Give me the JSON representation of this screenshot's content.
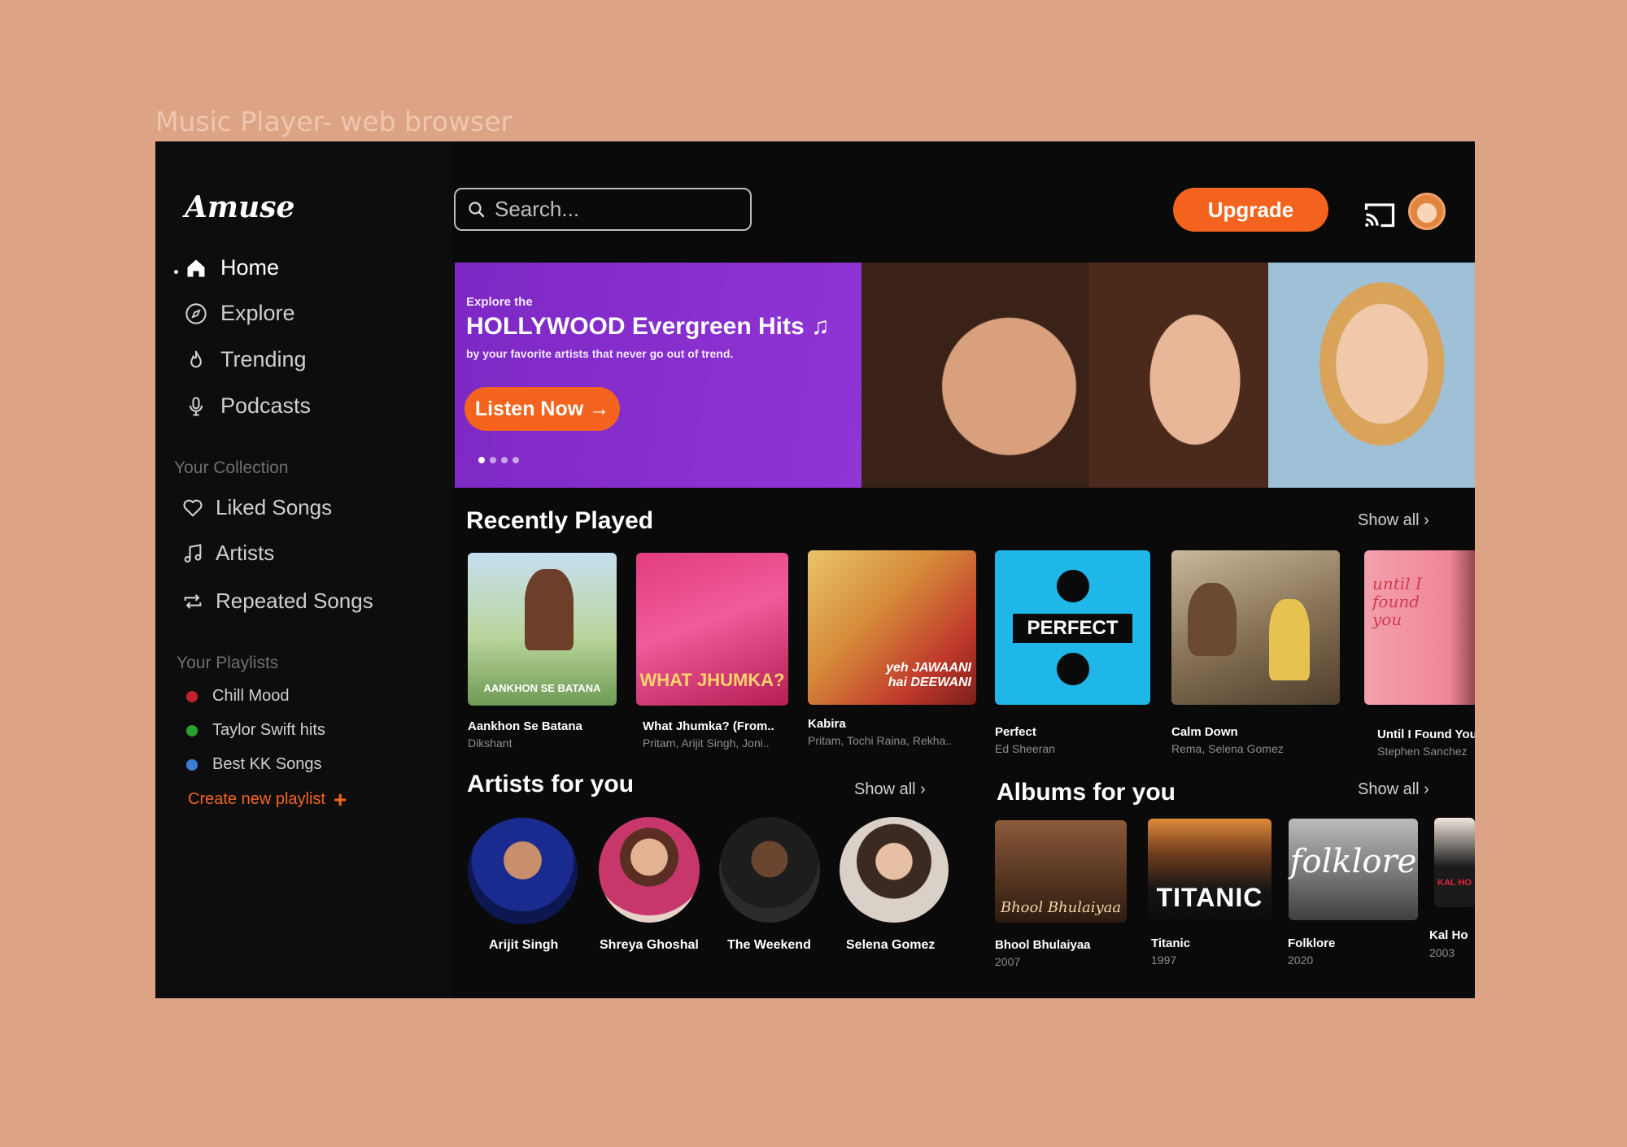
{
  "caption": "Music Player- web browser",
  "brand": {
    "logo": "Amuse"
  },
  "nav": [
    {
      "label": "Home",
      "icon": "home-icon",
      "active": true
    },
    {
      "label": "Explore",
      "icon": "compass-icon"
    },
    {
      "label": "Trending",
      "icon": "flame-icon"
    },
    {
      "label": "Podcasts",
      "icon": "microphone-icon"
    }
  ],
  "collection": {
    "title": "Your Collection",
    "items": [
      {
        "label": "Liked Songs",
        "icon": "heart-icon"
      },
      {
        "label": "Artists",
        "icon": "music-note-icon"
      },
      {
        "label": "Repeated Songs",
        "icon": "repeat-icon"
      }
    ]
  },
  "playlists": {
    "title": "Your Playlists",
    "items": [
      {
        "label": "Chill Mood",
        "color": "#c4222b"
      },
      {
        "label": "Taylor Swift hits",
        "color": "#2ca02c"
      },
      {
        "label": "Best KK Songs",
        "color": "#3a7bd5"
      }
    ],
    "create_label": "Create new playlist",
    "create_symbol": "+"
  },
  "topbar": {
    "search_placeholder": "Search...",
    "upgrade_label": "Upgrade"
  },
  "banner": {
    "kicker": "Explore the",
    "title": "HOLLYWOOD Evergreen Hits",
    "title_glyph": "♫",
    "subtitle": "by your favorite artists that never go out of trend.",
    "cta": "Listen Now →",
    "slides": 4,
    "active_slide": 1
  },
  "recently_played": {
    "title": "Recently Played",
    "show_all": "Show all ›",
    "items": [
      {
        "title": "Aankhon Se Batana",
        "subtitle": "Dikshant",
        "cover_text": "AANKHON SE BATANA"
      },
      {
        "title": "What Jhumka? (From..",
        "subtitle": "Pritam, Arijit Singh, Joni..",
        "cover_text": "WHAT JHUMKA?"
      },
      {
        "title": "Kabira",
        "subtitle": "Pritam, Tochi Raina, Rekha..",
        "cover_text": "yeh JAWAANI hai DEEWANI"
      },
      {
        "title": "Perfect",
        "subtitle": "Ed Sheeran",
        "cover_text": "PERFECT"
      },
      {
        "title": "Calm Down",
        "subtitle": "Rema, Selena Gomez",
        "cover_text": ""
      },
      {
        "title": "Until I Found You",
        "subtitle": "Stephen Sanchez",
        "cover_text": "until I found you"
      }
    ]
  },
  "artists": {
    "title": "Artists for you",
    "show_all": "Show all ›",
    "items": [
      {
        "name": "Arijit Singh"
      },
      {
        "name": "Shreya Ghoshal"
      },
      {
        "name": "The Weekend"
      },
      {
        "name": "Selena Gomez"
      }
    ]
  },
  "albums": {
    "title": "Albums for you",
    "show_all": "Show all ›",
    "items": [
      {
        "title": "Bhool Bhulaiyaa",
        "year": "2007",
        "cover_text": "Bhool Bhulaiyaa"
      },
      {
        "title": "Titanic",
        "year": "1997",
        "cover_text": "TITANIC"
      },
      {
        "title": "Folklore",
        "year": "2020",
        "cover_text": "folklore"
      },
      {
        "title": "Kal Ho",
        "year": "2003",
        "cover_text": "KAL HO"
      }
    ]
  },
  "colors": {
    "accent": "#f5641e",
    "background": "#0a0a0b",
    "page": "#dda385"
  }
}
